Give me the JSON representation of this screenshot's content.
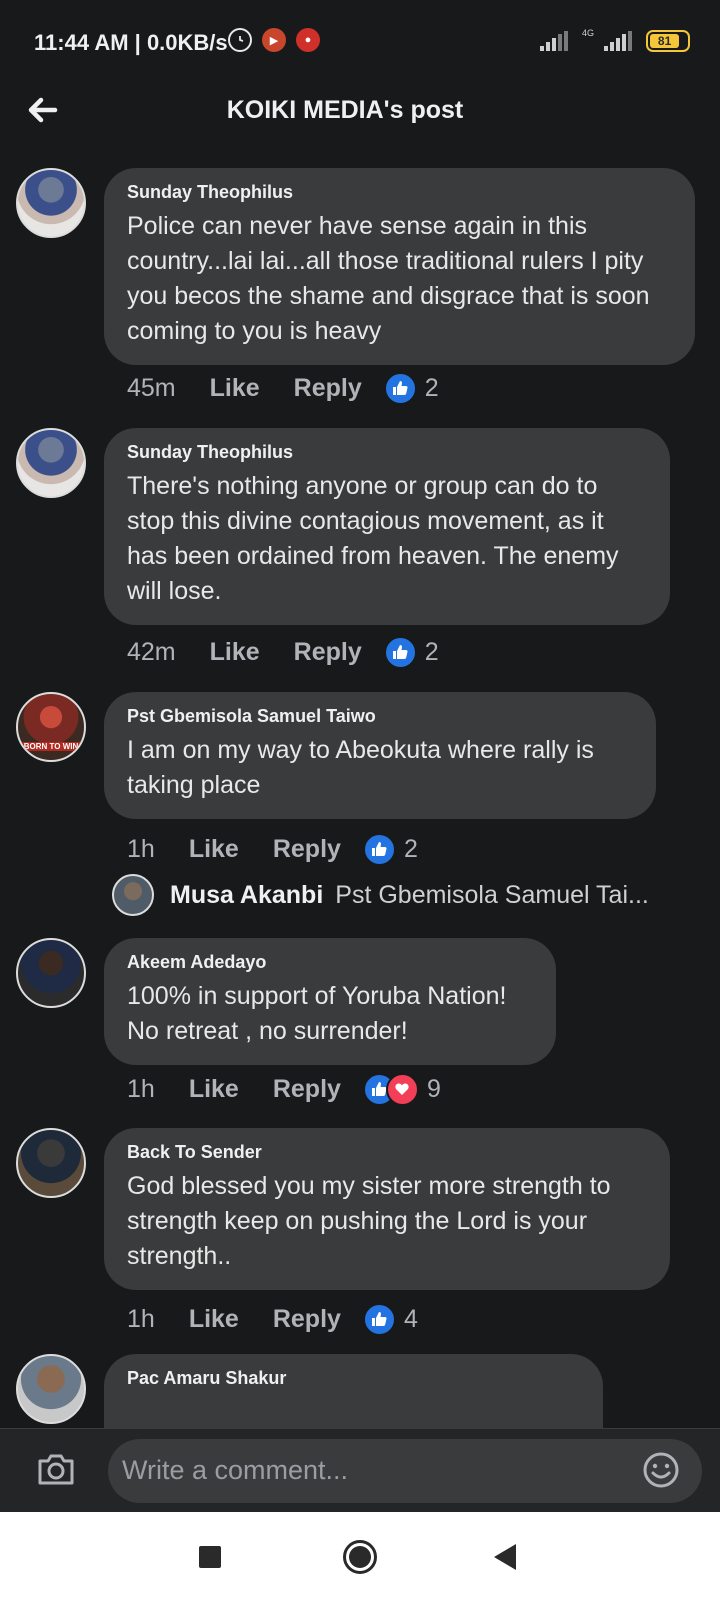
{
  "status_bar": {
    "time": "11:44 AM | 0.0KB/s",
    "network_label": "4G",
    "battery_level": "81"
  },
  "header": {
    "title": "KOIKI MEDIA's post"
  },
  "comments": [
    {
      "author": "Sunday Theophilus",
      "text": "Police can never have sense again in this country...lai lai...all those traditional rulers I pity you becos the shame and disgrace that is soon coming to you is heavy",
      "time": "45m",
      "like_label": "Like",
      "reply_label": "Reply",
      "reaction_count": "2"
    },
    {
      "author": "Sunday Theophilus",
      "text": "There's nothing anyone or group can do to stop this divine contagious movement, as it has been ordained from heaven. The enemy will lose.",
      "time": "42m",
      "like_label": "Like",
      "reply_label": "Reply",
      "reaction_count": "2"
    },
    {
      "author": "Pst Gbemisola Samuel Taiwo",
      "text": "I am on my way to Abeokuta where  rally is taking place",
      "time": "1h",
      "like_label": "Like",
      "reply_label": "Reply",
      "reaction_count": "2",
      "avatar_caption": "BORN TO WIN"
    },
    {
      "author": "Akeem Adedayo",
      "text": "100% in support of Yoruba Nation! No retreat , no surrender!",
      "time": "1h",
      "like_label": "Like",
      "reply_label": "Reply",
      "reaction_count": "9"
    },
    {
      "author": "Back To Sender",
      "text": "God blessed you my sister more strength to strength keep on pushing the Lord is your strength..",
      "time": "1h",
      "like_label": "Like",
      "reply_label": "Reply",
      "reaction_count": "4"
    },
    {
      "author": "Pac Amaru Shakur"
    }
  ],
  "reply_preview": {
    "name": "Musa Akanbi",
    "snippet": "Pst Gbemisola Samuel Tai..."
  },
  "composer": {
    "placeholder": "Write a comment..."
  },
  "colors": {
    "background": "#18191a",
    "bubble": "#3a3b3c",
    "like_blue": "#2374e1",
    "love_red": "#f33e58",
    "battery": "#f5c53a"
  },
  "icons": [
    "back-arrow-icon",
    "like-reaction-icon",
    "love-reaction-icon",
    "camera-icon",
    "emoji-icon",
    "alarm-icon"
  ]
}
